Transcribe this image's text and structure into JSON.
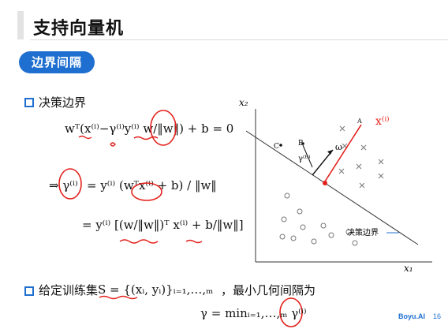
{
  "header": {
    "title": "支持向量机"
  },
  "section": {
    "label": "边界间隔"
  },
  "bullets": {
    "decision_boundary": "决策边界",
    "training_set_prefix": "给定训练集",
    "training_set_suffix": "，最小几何间隔为"
  },
  "formulas": {
    "eq1": "wᵀ(x⁽ⁱ⁾−γ⁽ⁱ⁾y⁽ⁱ⁾ w/‖w‖) + b = 0",
    "eq2_lhs": "⇒ γ⁽ⁱ⁾",
    "eq2_rhs": "= y⁽ⁱ⁾ (wᵀx⁽ⁱ⁾ + b) / ‖w‖",
    "eq3": "= y⁽ⁱ⁾ [(w/‖w‖)ᵀ x⁽ⁱ⁾ + b/‖w‖]",
    "training_set": "S = {(xᵢ, yᵢ)}ᵢ₌₁,…,ₘ",
    "min_margin": "γ = minᵢ₌₁,…,ₘ γ⁽ⁱ⁾"
  },
  "diagram": {
    "x_axis_label": "x₁",
    "y_axis_label": "x₂",
    "boundary_label": "决策边界",
    "point_c_label": "C",
    "point_b_label": "B",
    "point_a_label": "A",
    "gamma_label": "γ⁽ᴮ⁾",
    "omega_label": "ω",
    "handwritten_label": "x⁽ⁱ⁾"
  },
  "footer": {
    "brand": "Boyu.AI",
    "page": "16"
  },
  "colors": {
    "accent": "#1f6fd0",
    "annotation": "#e3201b"
  }
}
